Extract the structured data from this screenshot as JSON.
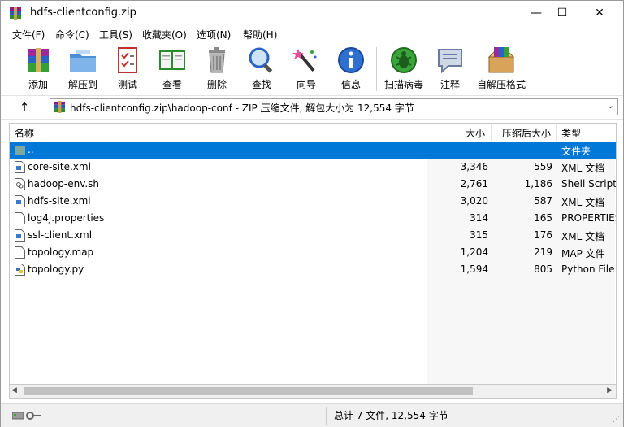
{
  "window": {
    "title": "hdfs-clientconfig.zip",
    "minimize": "—",
    "maximize": "☐",
    "close": "✕"
  },
  "menu": [
    "文件(F)",
    "命令(C)",
    "工具(S)",
    "收藏夹(O)",
    "选项(N)",
    "帮助(H)"
  ],
  "toolbar": [
    {
      "label": "添加",
      "icon": "add-archive-icon"
    },
    {
      "label": "解压到",
      "icon": "extract-folder-icon"
    },
    {
      "label": "测试",
      "icon": "test-checklist-icon"
    },
    {
      "label": "查看",
      "icon": "view-book-icon"
    },
    {
      "label": "删除",
      "icon": "delete-trash-icon"
    },
    {
      "label": "查找",
      "icon": "find-magnifier-icon"
    },
    {
      "label": "向导",
      "icon": "wizard-wand-icon"
    },
    {
      "label": "信息",
      "icon": "info-icon"
    },
    {
      "label": "扫描病毒",
      "icon": "virus-scan-icon"
    },
    {
      "label": "注释",
      "icon": "comment-icon"
    },
    {
      "label": "自解压格式",
      "icon": "sfx-box-icon"
    }
  ],
  "address": {
    "up": "↑",
    "path": "hdfs-clientconfig.zip\\hadoop-conf - ZIP 压缩文件, 解包大小为 12,554 字节",
    "dropdown": "⌄"
  },
  "columns": {
    "name": "名称",
    "size": "大小",
    "packed": "压缩后大小",
    "type": "类型",
    "sort_indicator": "^"
  },
  "files": [
    {
      "name": "..",
      "size": "",
      "packed": "",
      "type": "文件夹",
      "icon": "parent-folder-icon",
      "selected": true
    },
    {
      "name": "core-site.xml",
      "size": "3,346",
      "packed": "559",
      "type": "XML 文档",
      "icon": "xml-file-icon"
    },
    {
      "name": "hadoop-env.sh",
      "size": "2,761",
      "packed": "1,186",
      "type": "Shell Script",
      "icon": "shell-script-icon"
    },
    {
      "name": "hdfs-site.xml",
      "size": "3,020",
      "packed": "587",
      "type": "XML 文档",
      "icon": "xml-file-icon"
    },
    {
      "name": "log4j.properties",
      "size": "314",
      "packed": "165",
      "type": "PROPERTIES",
      "icon": "blank-file-icon"
    },
    {
      "name": "ssl-client.xml",
      "size": "315",
      "packed": "176",
      "type": "XML 文档",
      "icon": "xml-file-icon"
    },
    {
      "name": "topology.map",
      "size": "1,204",
      "packed": "219",
      "type": "MAP 文件",
      "icon": "blank-file-icon"
    },
    {
      "name": "topology.py",
      "size": "1,594",
      "packed": "805",
      "type": "Python File",
      "icon": "python-file-icon"
    }
  ],
  "status": {
    "summary": "总计 7 文件, 12,554 字节"
  },
  "colors": {
    "selection": "#0078d7",
    "accent_green": "#3aa53a"
  }
}
